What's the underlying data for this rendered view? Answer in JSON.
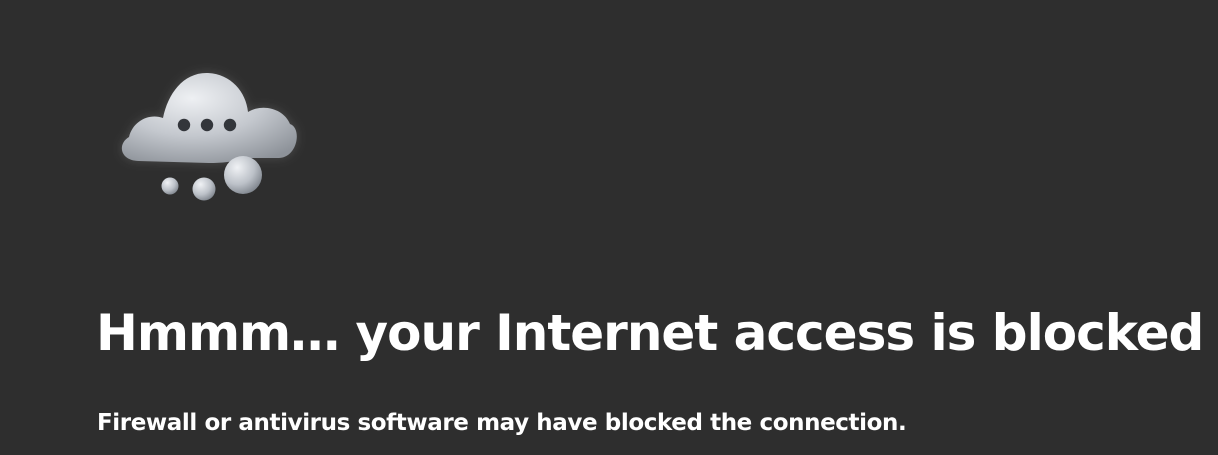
{
  "error": {
    "illustration": "cloud-thinking-icon",
    "title": "Hmmm… your Internet access is blocked",
    "subtitle": "Firewall or antivirus software may have blocked the connection."
  },
  "colors": {
    "background": "#2e2e2e",
    "text": "#ffffff",
    "cloud": "#c7cbd1"
  }
}
